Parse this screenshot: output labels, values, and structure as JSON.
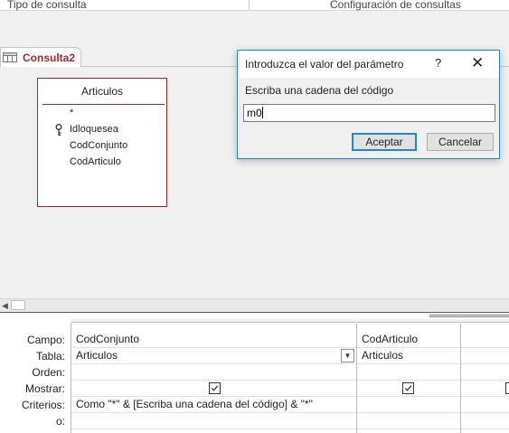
{
  "ribbon": {
    "group_labels": [
      "Tipo de consulta",
      "Configuración de consultas"
    ]
  },
  "document_tab": {
    "label": "Consulta2",
    "icon": "query-design-icon"
  },
  "field_list": {
    "title": "Articulos",
    "fields": [
      "*",
      "Idloquesea",
      "CodConjunto",
      "CodArticulo"
    ],
    "primary_key_icon": "key-icon"
  },
  "grid": {
    "row_labels": [
      "Campo:",
      "Tabla:",
      "Orden:",
      "Mostrar:",
      "Criterios:",
      "o:"
    ],
    "columns": [
      {
        "campo": "CodConjunto",
        "tabla": "Articulos",
        "orden": "",
        "mostrar": true,
        "criterios": "Como \"*\" & [Escriba una cadena del código] & \"*\"",
        "o": ""
      },
      {
        "campo": "CodArticulo",
        "tabla": "Articulos",
        "orden": "",
        "mostrar": true,
        "criterios": "",
        "o": ""
      },
      {
        "campo": "",
        "tabla": "",
        "orden": "",
        "mostrar": false,
        "criterios": "",
        "o": ""
      }
    ]
  },
  "dialog": {
    "title": "Introduzca el valor del parámetro",
    "help_label": "?",
    "close_label": "✕",
    "prompt": "Escriba una cadena del código",
    "input_value": "m0",
    "ok_label": "Aceptar",
    "cancel_label": "Cancelar"
  },
  "colors": {
    "accent_access": "#a4262c",
    "dialog_border": "#1e88c8"
  }
}
